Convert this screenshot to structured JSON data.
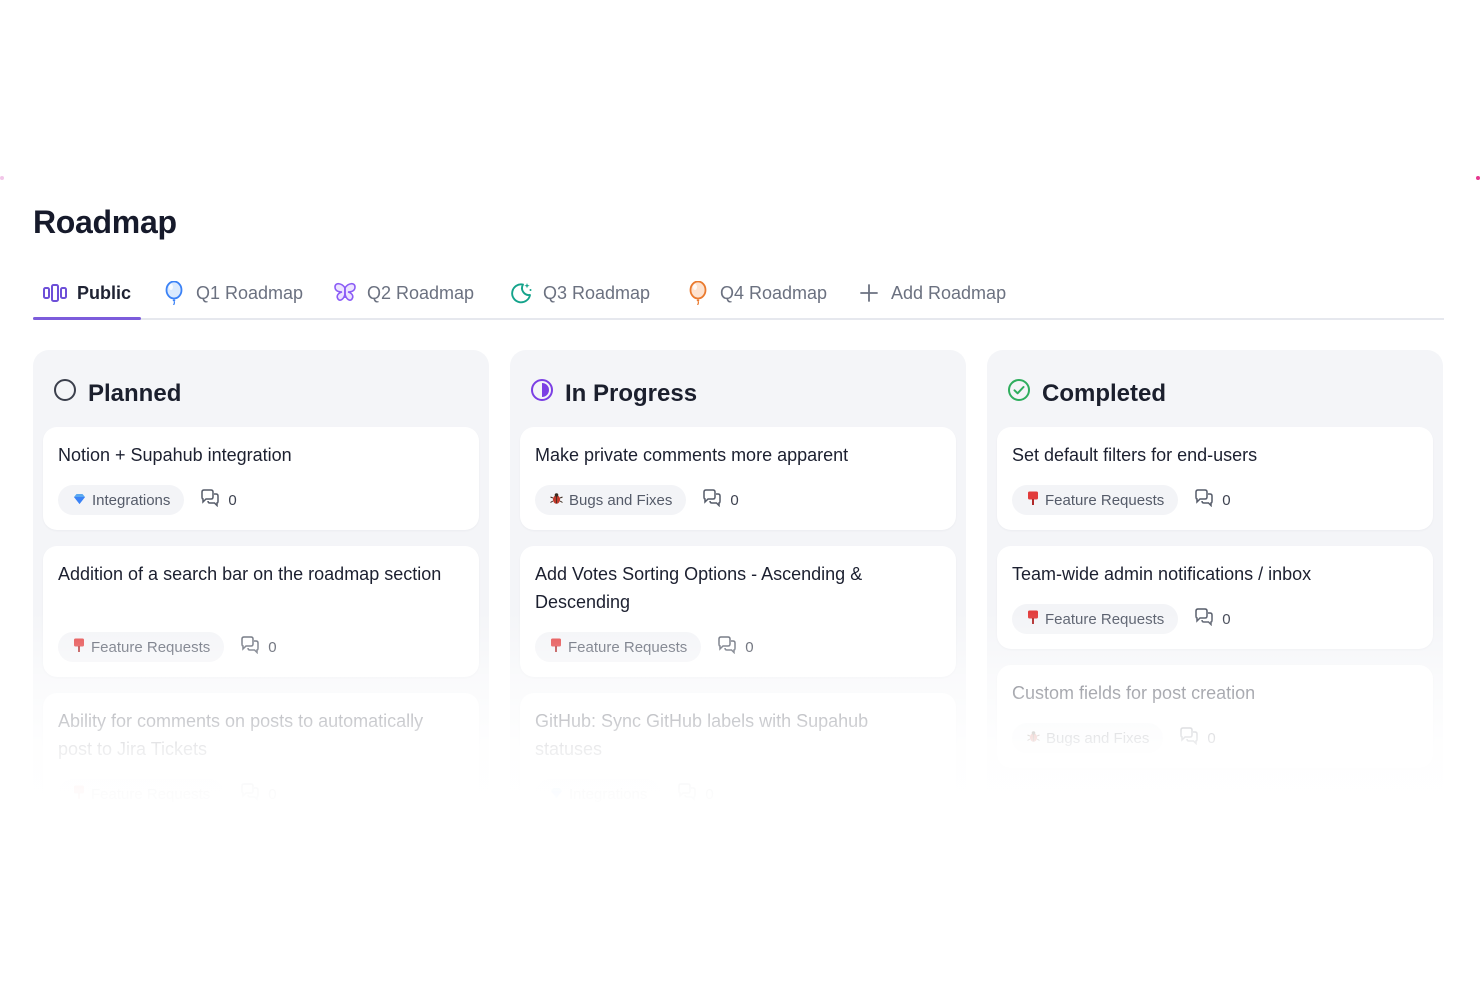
{
  "page": {
    "title": "Roadmap"
  },
  "tabs": [
    {
      "label": "Public",
      "icon": "columns-icon",
      "active": true
    },
    {
      "label": "Q1 Roadmap",
      "icon": "balloon-icon"
    },
    {
      "label": "Q2 Roadmap",
      "icon": "butterfly-icon"
    },
    {
      "label": "Q3 Roadmap",
      "icon": "moon-stars-icon"
    },
    {
      "label": "Q4 Roadmap",
      "icon": "balloon-icon"
    },
    {
      "label": "Add Roadmap",
      "icon": "plus-icon"
    }
  ],
  "columns": [
    {
      "title": "Planned",
      "status_icon": "circle-outline-icon",
      "cards": [
        {
          "title": "Notion + Supahub integration",
          "tag": "Integrations",
          "tag_icon": "gem-icon",
          "comments": "0"
        },
        {
          "title": "Addition of a search bar on the roadmap section",
          "tag": "Feature Requests",
          "tag_icon": "pushpin-icon",
          "comments": "0"
        },
        {
          "title": "Ability for comments on posts to automatically post to Jira Tickets",
          "tag": "Feature Requests",
          "tag_icon": "pushpin-icon",
          "comments": "0"
        }
      ]
    },
    {
      "title": "In Progress",
      "status_icon": "half-circle-icon",
      "cards": [
        {
          "title": "Make private comments more apparent",
          "tag": "Bugs and Fixes",
          "tag_icon": "bug-icon",
          "comments": "0"
        },
        {
          "title": "Add Votes Sorting Options - Ascending & Descending",
          "tag": "Feature Requests",
          "tag_icon": "pushpin-icon",
          "comments": "0"
        },
        {
          "title": "GitHub: Sync GitHub labels with Supahub statuses",
          "tag": "Integrations",
          "tag_icon": "gem-icon",
          "comments": "0"
        }
      ]
    },
    {
      "title": "Completed",
      "status_icon": "check-circle-icon",
      "cards": [
        {
          "title": "Set default filters for end-users",
          "tag": "Feature Requests",
          "tag_icon": "pushpin-icon",
          "comments": "0"
        },
        {
          "title": "Team-wide admin notifications / inbox",
          "tag": "Feature Requests",
          "tag_icon": "pushpin-icon",
          "comments": "0"
        },
        {
          "title": "Custom fields for post creation",
          "tag": "Bugs and Fixes",
          "tag_icon": "bug-icon",
          "comments": "0"
        }
      ]
    }
  ],
  "colors": {
    "accent": "#7c5cdb",
    "planned": "#3b3f4c",
    "in_progress": "#7b3fe4",
    "completed": "#2fae5e"
  }
}
